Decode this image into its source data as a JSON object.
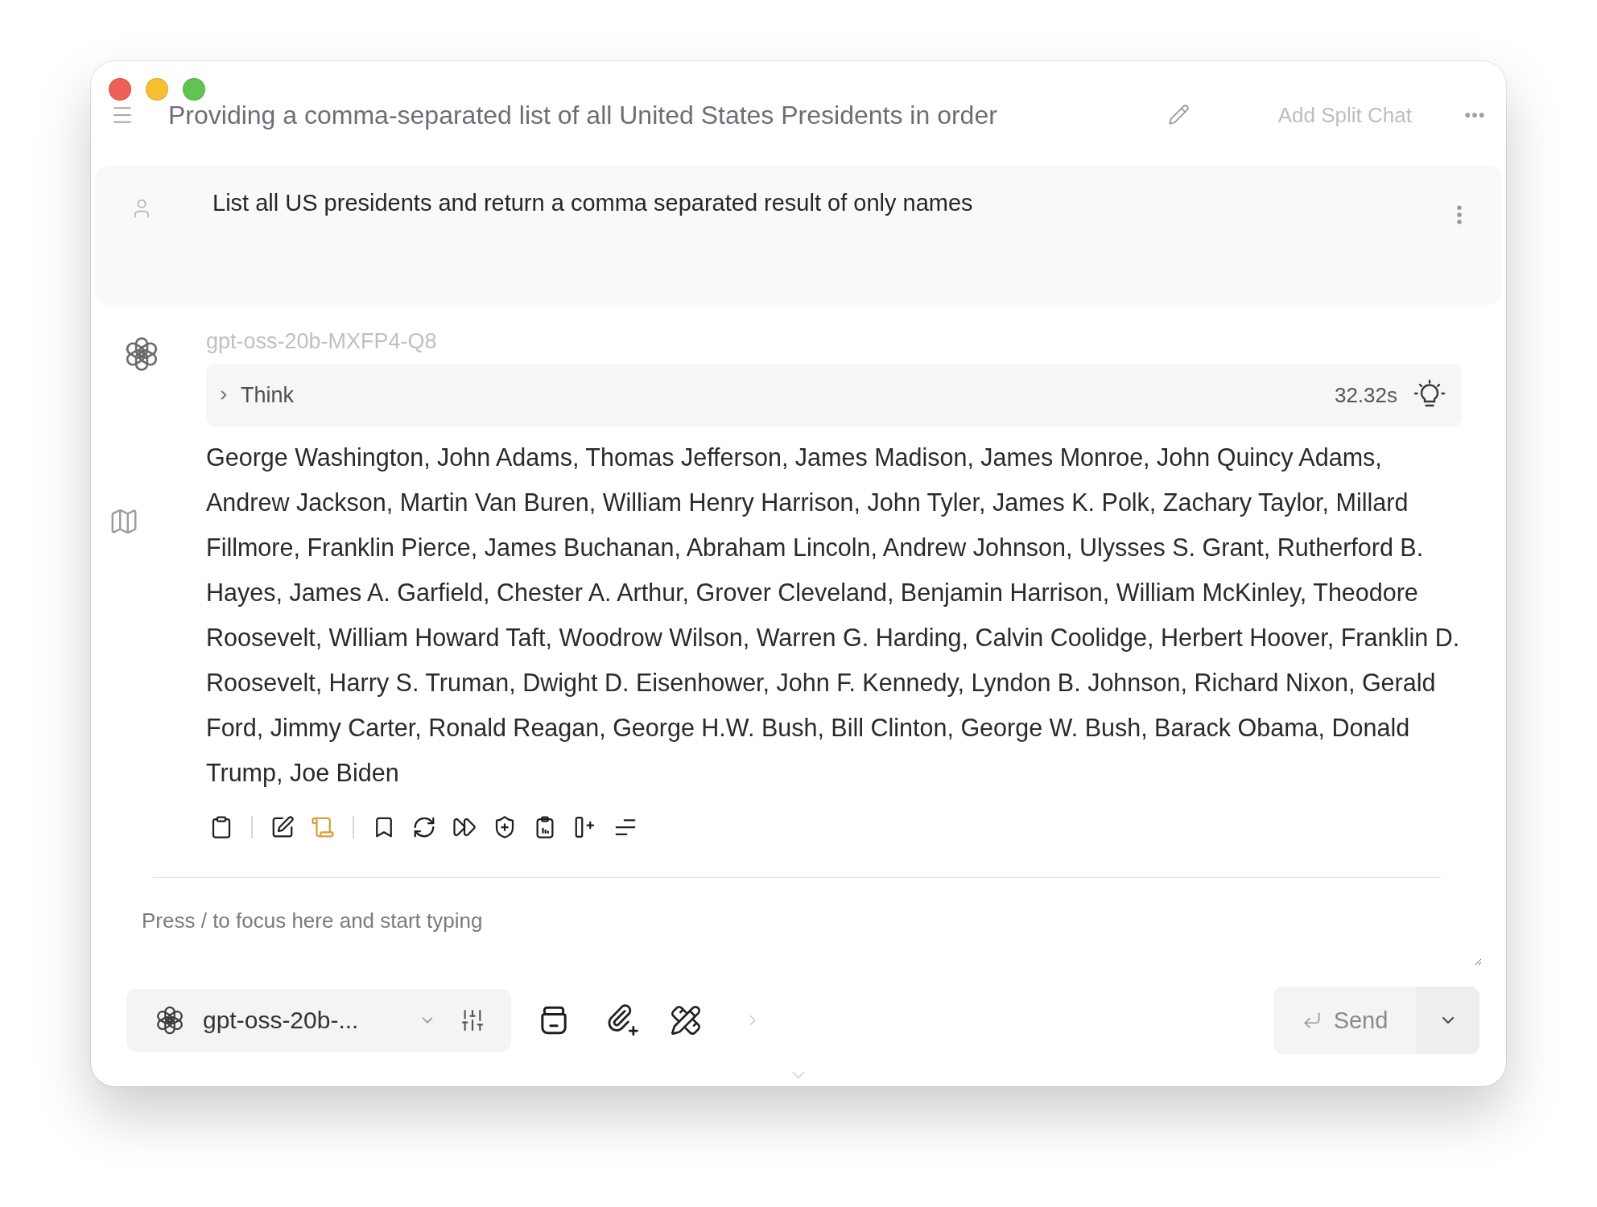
{
  "window": {
    "title": "Providing a comma-separated list of all United States Presidents in order"
  },
  "header_actions": {
    "split_chat": "Add Split Chat"
  },
  "messages": [
    {
      "kind": "user",
      "text": "List all US presidents and return a comma separated result of only names"
    },
    {
      "kind": "assistant",
      "model": "gpt-oss-20b-MXFP4-Q8",
      "reasoning": {
        "label": "Think",
        "duration": "32.32s",
        "expanded": false
      },
      "text": "George Washington, John Adams, Thomas Jefferson, James Madison, James Monroe, John Quincy Adams, Andrew Jackson, Martin Van Buren, William Henry Harrison, John Tyler, James K. Polk, Zachary Taylor, Millard Fillmore, Franklin Pierce, James Buchanan, Abraham Lincoln, Andrew Johnson, Ulysses S. Grant, Rutherford B. Hayes, James A. Garfield, Chester A. Arthur, Grover Cleveland, Benjamin Harrison, William McKinley, Theodore Roosevelt, William Howard Taft, Woodrow Wilson, Warren G. Harding, Calvin Coolidge, Herbert Hoover, Franklin D. Roosevelt, Harry S. Truman, Dwight D. Eisenhower, John F. Kennedy, Lyndon B. Johnson, Richard Nixon, Gerald Ford, Jimmy Carter, Ronald Reagan, George H.W. Bush, Bill Clinton, George W. Bush, Barack Obama, Donald Trump, Joe Biden",
      "actions": [
        {
          "active": false
        },
        {
          "active": false
        },
        {
          "active": true
        },
        {
          "active": false
        },
        {
          "active": false
        },
        {
          "active": false
        },
        {
          "active": false
        },
        {
          "active": false
        },
        {
          "active": false
        },
        {
          "active": false
        }
      ]
    }
  ],
  "composer": {
    "placeholder": "Press / to focus here and start typing",
    "model_selector": {
      "value": "gpt-oss-20b-..."
    },
    "send_button": {
      "label": "Send"
    }
  }
}
